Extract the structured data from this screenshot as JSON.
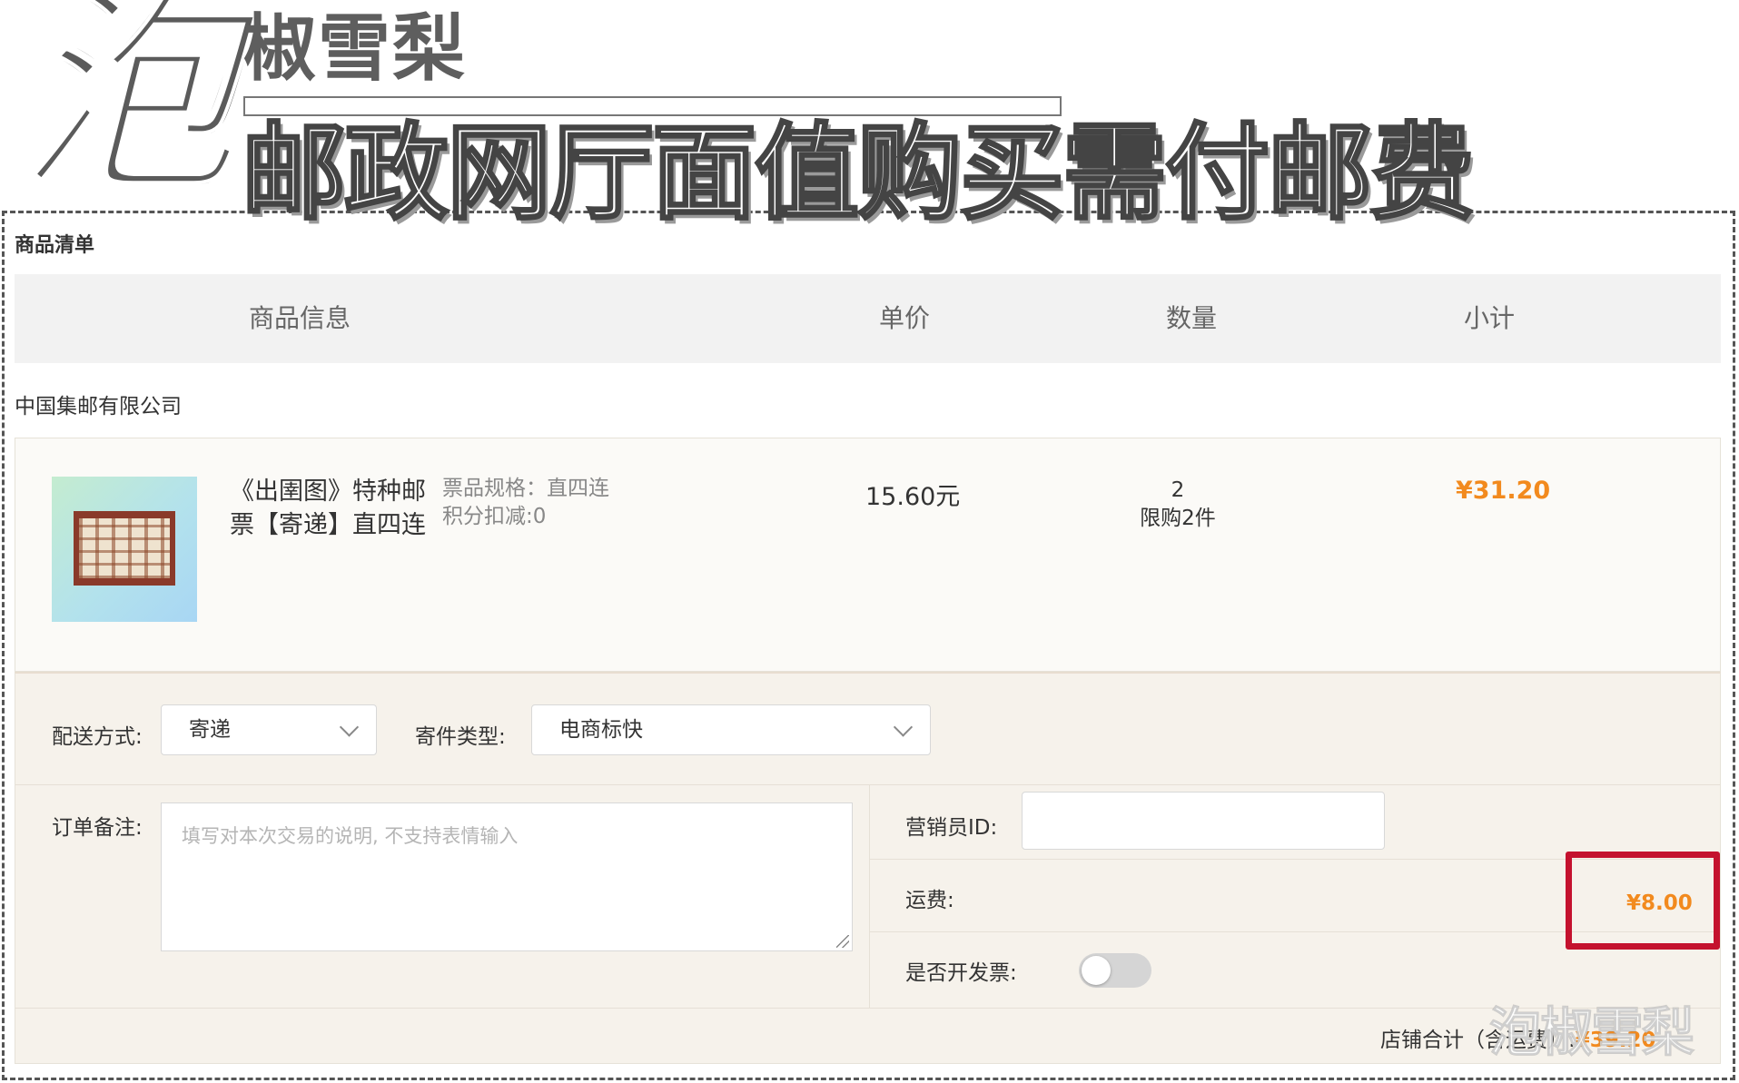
{
  "overlay": {
    "big_char": "泡",
    "author": "椒雪梨",
    "headline": "邮政网厅面值购买需付邮费",
    "watermark": "泡椒雪梨"
  },
  "section_title": "商品清单",
  "table_header": {
    "product_info": "商品信息",
    "unit_price": "单价",
    "quantity": "数量",
    "subtotal": "小计"
  },
  "shop_name": "中国集邮有限公司",
  "product": {
    "name": "《出圉图》特种邮票【寄递】直四连",
    "spec_label": "票品规格：",
    "spec_value": "直四连",
    "points_label": "积分扣减:",
    "points_value": "0",
    "price": "15.60元",
    "quantity": "2",
    "limit": "限购2件",
    "subtotal": "¥31.20"
  },
  "options": {
    "delivery_label": "配送方式:",
    "delivery_value": "寄递",
    "mail_type_label": "寄件类型:",
    "mail_type_value": "电商标快",
    "note_label": "订单备注:",
    "note_placeholder": "填写对本次交易的说明, 不支持表情输入",
    "marketer_label": "营销员ID:",
    "marketer_value": "",
    "shipping_label": "运费:",
    "shipping_value": "¥8.00",
    "invoice_label": "是否开发票:",
    "invoice_on": false,
    "shop_total_label": "店铺合计（含运费）:",
    "shop_total_value": "¥39.20"
  },
  "colors": {
    "accent": "#f28a1e",
    "highlight": "#c4122e"
  }
}
